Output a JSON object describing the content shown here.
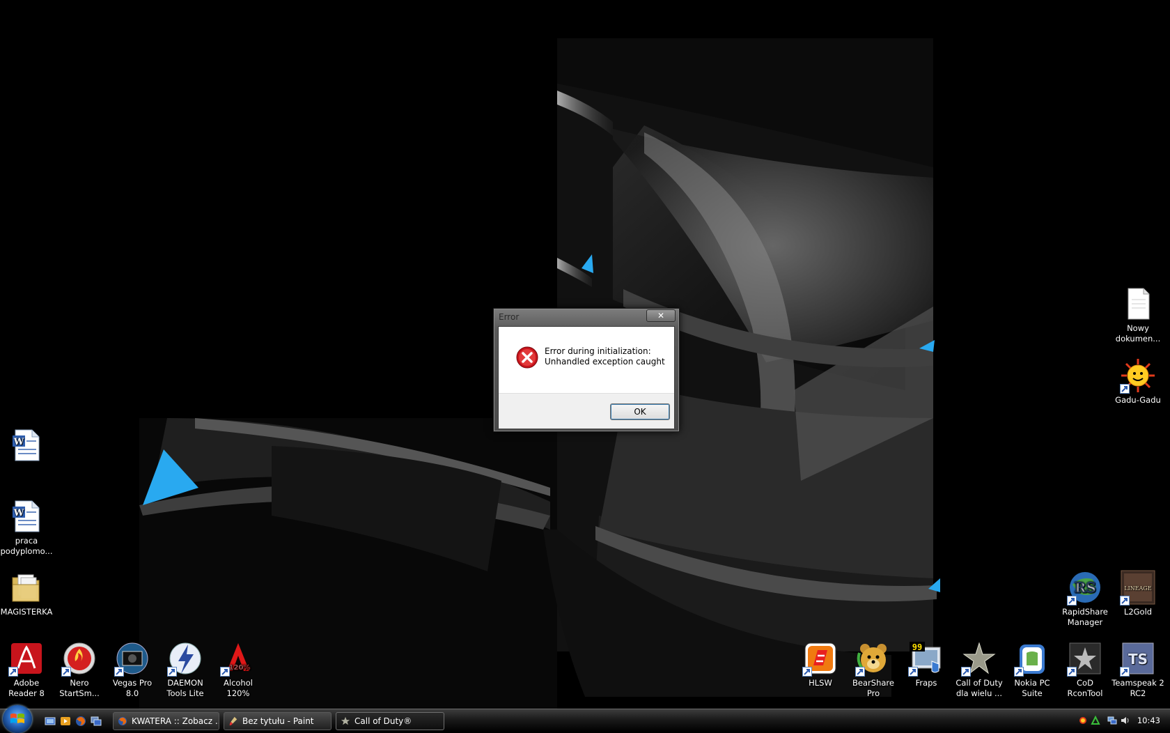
{
  "dialog": {
    "title": "Error",
    "close_symbol": "✕",
    "message_line1": "Error during initialization:",
    "message_line2": "Unhandled exception caught",
    "ok_label": "OK"
  },
  "desktop": {
    "left_icons": [
      {
        "label": ""
      },
      {
        "label": "praca podyplomo..."
      },
      {
        "label": "MAGISTERKA"
      }
    ],
    "right_icons": [
      {
        "label": "Nowy dokumen..."
      },
      {
        "label": "Gadu-Gadu"
      },
      {
        "label": "RapidShare Manager"
      },
      {
        "label": "L2Gold"
      }
    ],
    "bottom_left_icons": [
      {
        "label": "Adobe Reader 8"
      },
      {
        "label": "Nero StartSm..."
      },
      {
        "label": "Vegas Pro 8.0"
      },
      {
        "label": "DAEMON Tools Lite"
      },
      {
        "label": "Alcohol 120%"
      }
    ],
    "bottom_right_icons": [
      {
        "label": "HLSW"
      },
      {
        "label": "BearShare Pro"
      },
      {
        "label": "Fraps"
      },
      {
        "label": "Call of Duty dla wielu ..."
      },
      {
        "label": "Nokia PC Suite"
      },
      {
        "label": "CoD RconTool"
      },
      {
        "label": "Teamspeak 2 RC2"
      }
    ],
    "icon_glyphs": {
      "fraps": "99",
      "alcohol": "120%",
      "rapidshare": "RS",
      "lineage": "LINEAGE",
      "teamspeak": "TS",
      "word": "W"
    }
  },
  "taskbar": {
    "tasks": [
      {
        "label": "KWATERA :: Zobacz ..."
      },
      {
        "label": "Bez tytułu - Paint"
      },
      {
        "label": "Call of Duty®"
      }
    ],
    "clock": "10:43"
  },
  "colors": {
    "accent_blue": "#29a9f0",
    "error_red": "#c8141c",
    "taskbar_bg": "#1b1b1b"
  }
}
